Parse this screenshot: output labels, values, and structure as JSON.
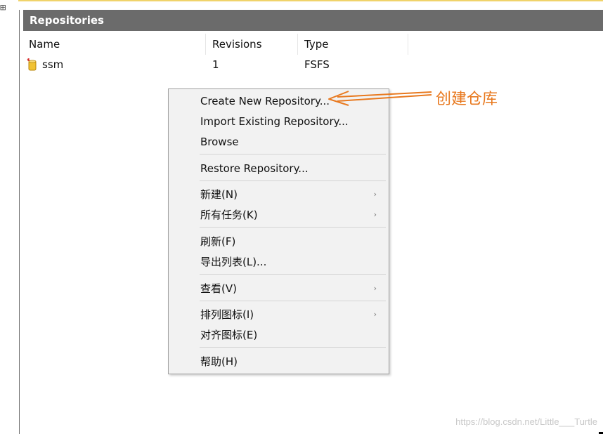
{
  "panel": {
    "title": "Repositories"
  },
  "columns": {
    "name": "Name",
    "revisions": "Revisions",
    "type": "Type"
  },
  "rows": [
    {
      "name": "ssm",
      "revisions": "1",
      "type": "FSFS",
      "icon": "repository-icon"
    }
  ],
  "context_menu": {
    "items": [
      {
        "label": "Create New Repository...",
        "has_submenu": false
      },
      {
        "label": "Import Existing Repository...",
        "has_submenu": false
      },
      {
        "label": "Browse",
        "has_submenu": false
      },
      {
        "label": "Restore Repository...",
        "has_submenu": false
      },
      {
        "label": "新建(N)",
        "has_submenu": true
      },
      {
        "label": "所有任务(K)",
        "has_submenu": true
      },
      {
        "label": "刷新(F)",
        "has_submenu": false
      },
      {
        "label": "导出列表(L)...",
        "has_submenu": false
      },
      {
        "label": "查看(V)",
        "has_submenu": true
      },
      {
        "label": "排列图标(I)",
        "has_submenu": true
      },
      {
        "label": "对齐图标(E)",
        "has_submenu": false
      },
      {
        "label": "帮助(H)",
        "has_submenu": false
      }
    ],
    "submenu_glyph": "›"
  },
  "annotation": {
    "text": "创建仓库",
    "color": "#e8791f"
  },
  "watermark": {
    "text": "https://blog.csdn.net/Little___Turtle"
  },
  "colors": {
    "header_bg": "#6b6b6b",
    "menu_bg": "#f2f2f2",
    "top_edge": "#f0d36a"
  }
}
